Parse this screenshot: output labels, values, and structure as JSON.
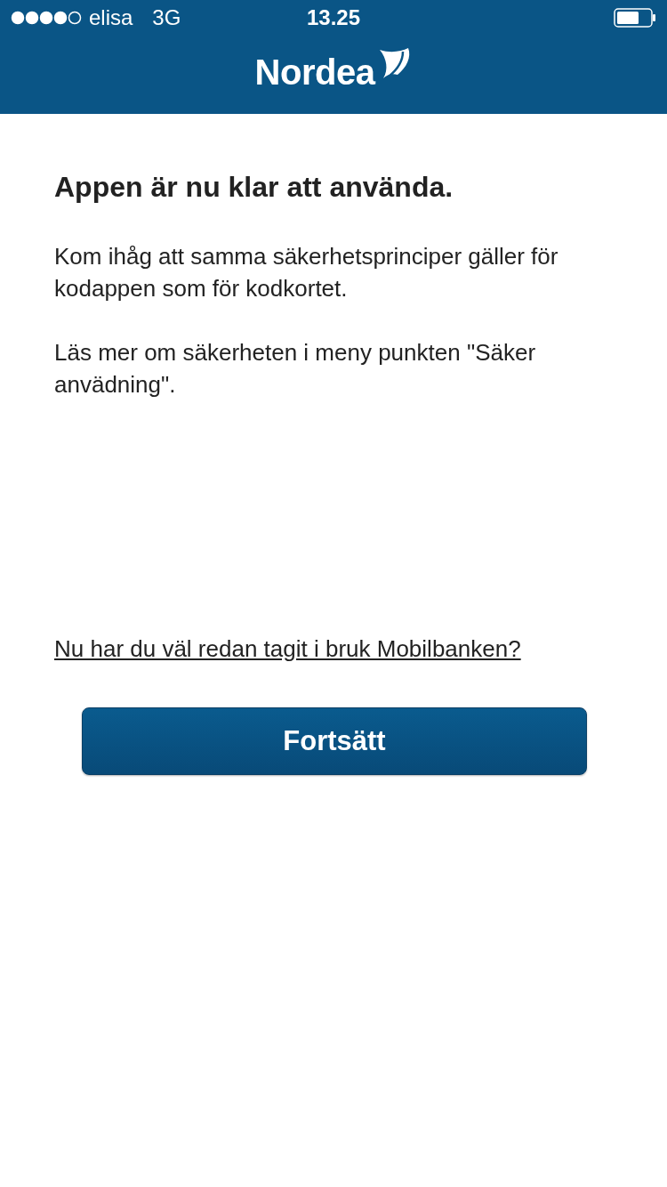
{
  "status_bar": {
    "carrier": "elisa",
    "network": "3G",
    "time": "13.25"
  },
  "header": {
    "logo": "Nordea"
  },
  "title": "Appen är nu klar att använda.",
  "paragraphs": [
    "Kom ihåg att samma säkerhetsprinciper gäller för kodappen som för kodkortet.",
    "Läs mer om säkerheten i meny punkten \"Säker anvädning\"."
  ],
  "link": "Nu har du väl redan tagit i bruk Mobilbanken?",
  "button": "Fortsätt"
}
